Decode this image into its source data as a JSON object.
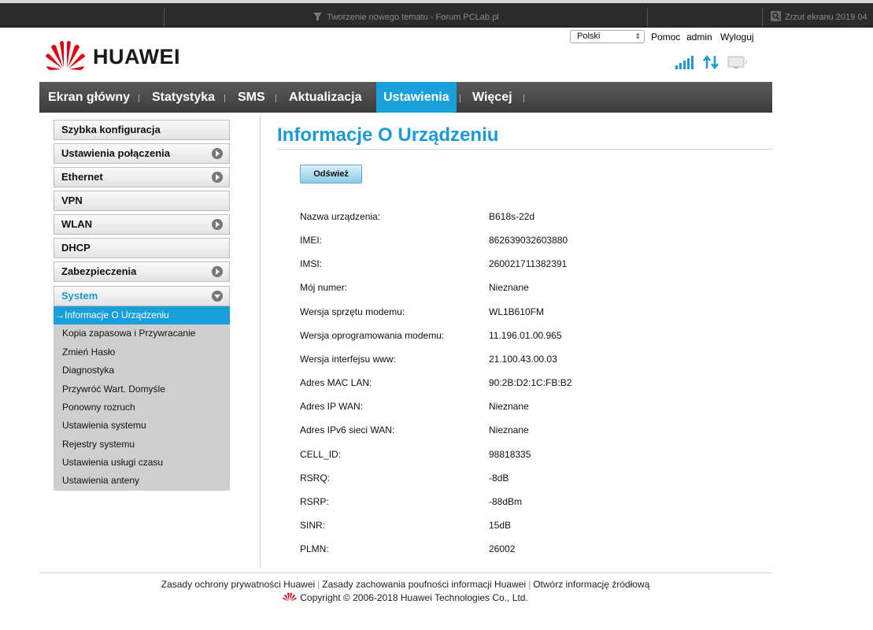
{
  "browser": {
    "tab_title": "Tworzenie nowego tematu - Forum PCLab.pl",
    "screenshot_tab_title": "Zrzut ekranu 2019 04"
  },
  "header": {
    "language_select": "Polski",
    "help_link": "Pomoc",
    "user_name": "admin",
    "logout_link": "Wyloguj",
    "brand": "HUAWEI",
    "brand_color": "#e60012",
    "status_icons": [
      "signal-strength-icon",
      "data-transfer-icon",
      "connected-device-icon"
    ]
  },
  "nav": {
    "items": [
      {
        "label": "Ekran główny"
      },
      {
        "label": "Statystyka"
      },
      {
        "label": "SMS"
      },
      {
        "label": "Aktualizacja"
      },
      {
        "label": "Ustawienia",
        "active": true
      },
      {
        "label": "Więcej"
      }
    ],
    "active_color": "#19a0da"
  },
  "sidebar": {
    "items": [
      {
        "label": "Szybka konfiguracja",
        "expandable": false
      },
      {
        "label": "Ustawienia połączenia",
        "expandable": true
      },
      {
        "label": "Ethernet",
        "expandable": true
      },
      {
        "label": "VPN",
        "expandable": false
      },
      {
        "label": "WLAN",
        "expandable": true
      },
      {
        "label": "DHCP",
        "expandable": false
      },
      {
        "label": "Zabezpieczenia",
        "expandable": true
      },
      {
        "label": "System",
        "expandable": true,
        "open": true
      }
    ],
    "submenu": [
      {
        "label": "Informacje O Urządzeniu",
        "active": true
      },
      {
        "label": "Kopia zapasowa i Przywracanie"
      },
      {
        "label": "Zmień Hasło"
      },
      {
        "label": "Diagnostyka"
      },
      {
        "label": "Przywróć Wart. Domyśle"
      },
      {
        "label": "Ponowny rozruch"
      },
      {
        "label": "Ustawienia systemu"
      },
      {
        "label": "Rejestry systemu"
      },
      {
        "label": "Ustawienia usługi czasu"
      },
      {
        "label": "Ustawienia anteny"
      }
    ],
    "active_arrow": "→"
  },
  "main": {
    "title": "Informacje O Urządzeniu",
    "refresh_button": "Odśwież",
    "rows": [
      {
        "label": "Nazwa urządzenia:",
        "value": "B618s-22d"
      },
      {
        "label": "IMEI:",
        "value": "862639032603880"
      },
      {
        "label": "IMSI:",
        "value": "260021711382391"
      },
      {
        "label": "Mój numer:",
        "value": "Nieznane"
      },
      {
        "label": "Wersja sprzętu modemu:",
        "value": "WL1B610FM"
      },
      {
        "label": "Wersja oprogramowania modemu:",
        "value": "11.196.01.00.965"
      },
      {
        "label": "Wersja interfejsu www:",
        "value": "21.100.43.00.03"
      },
      {
        "label": "Adres MAC LAN:",
        "value": "90:2B:D2:1C:FB:B2"
      },
      {
        "label": "Adres IP WAN:",
        "value": "Nieznane"
      },
      {
        "label": "Adres IPv6 sieci WAN:",
        "value": "Nieznane"
      },
      {
        "label": "CELL_ID:",
        "value": "98818335"
      },
      {
        "label": "RSRQ:",
        "value": "-8dB"
      },
      {
        "label": "RSRP:",
        "value": "-88dBm"
      },
      {
        "label": "SINR:",
        "value": "15dB"
      },
      {
        "label": "PLMN:",
        "value": "26002"
      }
    ]
  },
  "footer": {
    "privacy_link": "Zasady ochrony prywatności Huawei",
    "confidentiality_link": "Zasady zachowania poufności informacji Huawei",
    "open_source_link": "Otwórz informację źródłową",
    "copyright": "Copyright © 2006-2018 Huawei Technologies Co., Ltd."
  }
}
